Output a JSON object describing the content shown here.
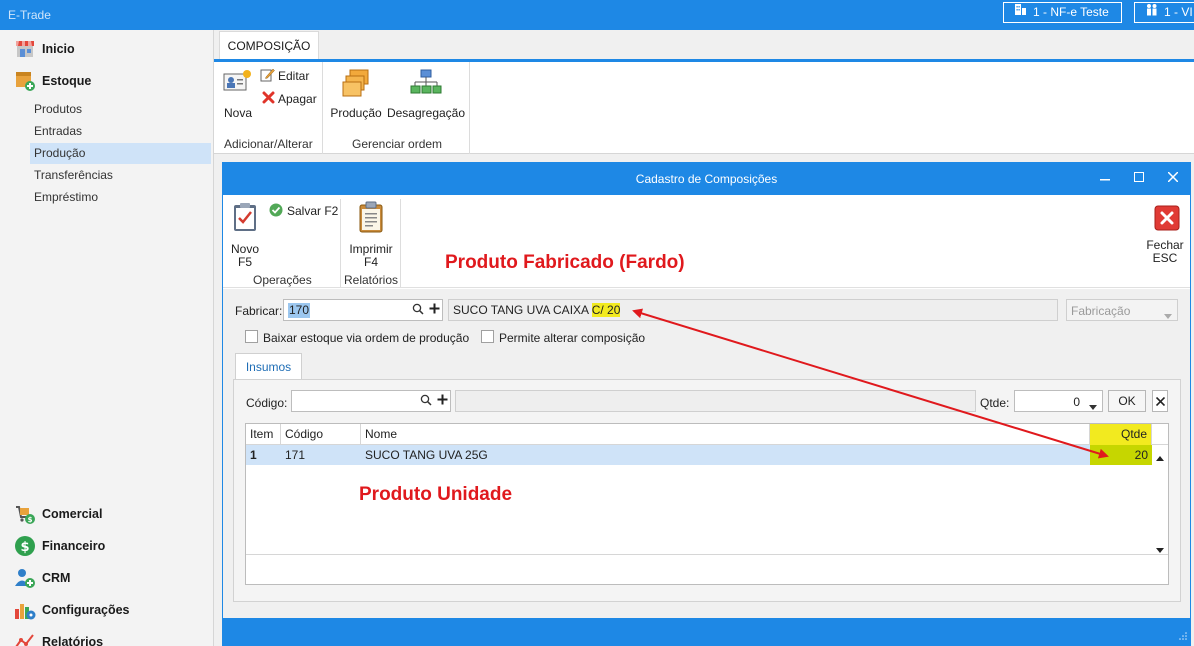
{
  "app": {
    "title": "E-Trade",
    "company_chip": "1 - NF-e Teste",
    "user_chip": "1 - VI"
  },
  "sidebar": {
    "sections": [
      {
        "label": "Inicio",
        "icon": "store-icon"
      },
      {
        "label": "Estoque",
        "icon": "stock-icon"
      },
      {
        "label": "Comercial",
        "icon": "cart-icon"
      },
      {
        "label": "Financeiro",
        "icon": "dollar-icon"
      },
      {
        "label": "CRM",
        "icon": "users-icon"
      },
      {
        "label": "Configurações",
        "icon": "settings-chart-icon"
      },
      {
        "label": "Relatórios",
        "icon": "report-icon"
      }
    ],
    "stock_items": [
      "Produtos",
      "Entradas",
      "Produção",
      "Transferências",
      "Empréstimo"
    ],
    "selected_item": "Produção"
  },
  "ribbon": {
    "tab": "COMPOSIÇÃO",
    "new_label": "Nova",
    "edit_label": "Editar",
    "delete_label": "Apagar",
    "group1_label": "Adicionar/Alterar",
    "production_label": "Produção",
    "disaggregation_label": "Desagregação",
    "group2_label": "Gerenciar ordem"
  },
  "dialog": {
    "title": "Cadastro de Composições",
    "toolbar": {
      "new_label_1": "Novo",
      "new_label_2": "F5",
      "save_label": "Salvar F2",
      "operations_label": "Operações",
      "print_label_1": "Imprimir",
      "print_label_2": "F4",
      "reports_label": "Relatórios",
      "close_label_1": "Fechar",
      "close_label_2": "ESC"
    },
    "form": {
      "fabricar_label": "Fabricar:",
      "fabricar_value": "170",
      "product_name_prefix": "SUCO TANG UVA CAIXA ",
      "product_name_highlight": "C/ 20",
      "type_value": "Fabricação",
      "checkbox1_label": "Baixar estoque via ordem de produção",
      "checkbox2_label": "Permite alterar composição"
    },
    "tab_insumos": "Insumos",
    "insumo_entry": {
      "codigo_label": "Código:",
      "qtde_label": "Qtde:",
      "qtde_value": "0",
      "ok_label": "OK"
    },
    "grid": {
      "headers": [
        "Item",
        "Código",
        "Nome",
        "Qtde"
      ],
      "rows": [
        {
          "item": "1",
          "codigo": "171",
          "nome": "SUCO TANG UVA 25G",
          "qtde": "20"
        }
      ]
    }
  },
  "annotations": {
    "fabricado": "Produto Fabricado (Fardo)",
    "unidade": "Produto Unidade",
    "highlight_color": "#f2ea1f",
    "arrow_color": "#e0191d"
  },
  "colors": {
    "accent": "#1e88e5",
    "selection": "#cfe3f8"
  }
}
